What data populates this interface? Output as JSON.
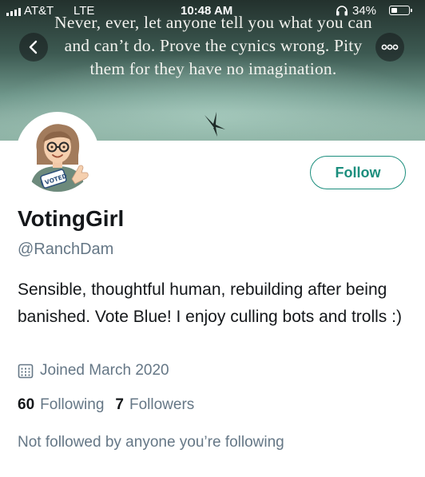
{
  "status_bar": {
    "carrier": "AT&T",
    "network": "LTE",
    "time": "10:48 AM",
    "battery_percent": "34%",
    "battery_level": 0.34
  },
  "banner": {
    "quote_line1": "Never, ever, let anyone tell you what you can",
    "quote_line2": "and can’t do.  Prove the cynics wrong.  Pity",
    "quote_line3": "them for they have no imagination."
  },
  "avatar": {
    "badge_text": "I VOTED"
  },
  "profile": {
    "display_name": "VotingGirl",
    "handle": "@RanchDam",
    "bio": "Sensible, thoughtful human, rebuilding after being banished. Vote Blue! I enjoy culling bots and trolls :)",
    "joined": "Joined March 2020",
    "following_count": "60",
    "following_label": "Following",
    "followers_count": "7",
    "followers_label": "Followers",
    "followed_by_note": "Not followed by anyone you’re following"
  },
  "actions": {
    "follow_label": "Follow"
  },
  "icons": {
    "back": "chevron-left-icon",
    "more": "more-dots-icon",
    "calendar": "calendar-icon",
    "headphones": "headphones-icon"
  },
  "colors": {
    "accent": "#1b8e7d",
    "secondary_text": "#657786",
    "primary_text": "#14171a"
  }
}
